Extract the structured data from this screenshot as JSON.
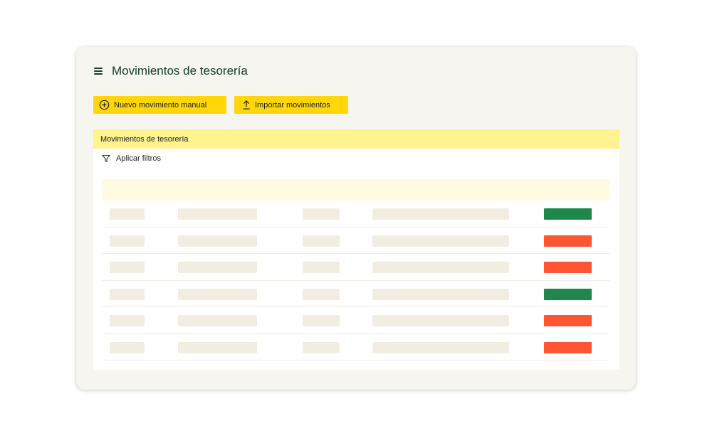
{
  "header": {
    "title": "Movimientos de tesorería"
  },
  "actions": {
    "new_manual_label": "Nuevo movimiento manual",
    "import_label": "Importar movimientos"
  },
  "panel": {
    "title": "Movimientos de tesorería",
    "filters_label": "Aplicar filtros"
  },
  "colors": {
    "button_accent": "#ffd60a",
    "panel_header": "#fff38f",
    "positive": "#1e874b",
    "negative": "#ff5533"
  },
  "rows": [
    {
      "amount_color": "#1e874b"
    },
    {
      "amount_color": "#ff5533"
    },
    {
      "amount_color": "#ff5533"
    },
    {
      "amount_color": "#1e874b"
    },
    {
      "amount_color": "#ff5533"
    },
    {
      "amount_color": "#ff5533"
    }
  ]
}
